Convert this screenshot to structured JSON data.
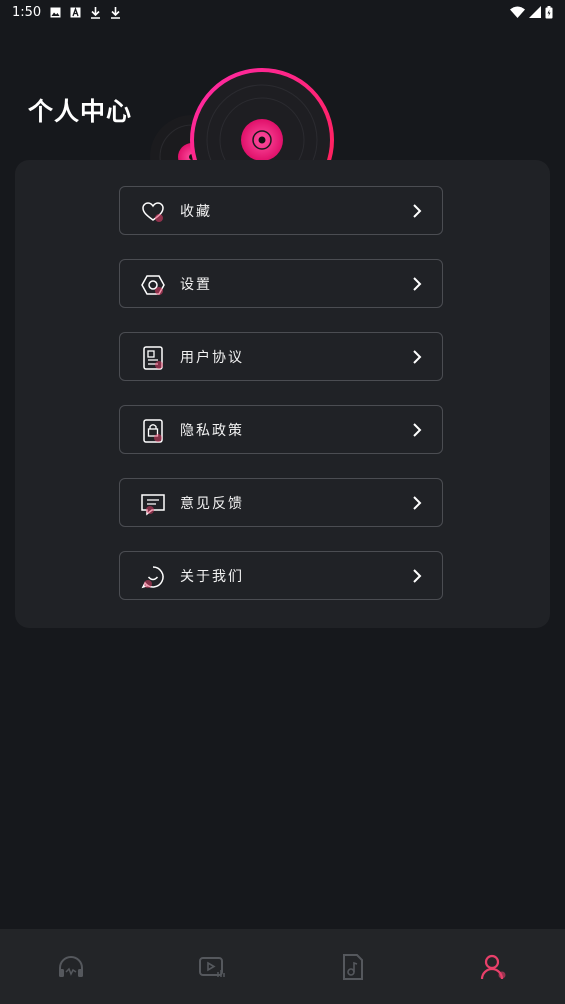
{
  "status_bar": {
    "time": "1:50"
  },
  "header": {
    "title": "个人中心"
  },
  "menu": {
    "items": [
      {
        "label": "收藏",
        "icon": "heart-icon"
      },
      {
        "label": "设置",
        "icon": "settings-hexagon-icon"
      },
      {
        "label": "用户协议",
        "icon": "user-agreement-icon"
      },
      {
        "label": "隐私政策",
        "icon": "privacy-lock-icon"
      },
      {
        "label": "意见反馈",
        "icon": "feedback-message-icon"
      },
      {
        "label": "关于我们",
        "icon": "about-chat-icon"
      }
    ]
  },
  "tab_bar": {
    "tabs": [
      {
        "icon": "headphones-icon",
        "active": false
      },
      {
        "icon": "video-icon",
        "active": false
      },
      {
        "icon": "music-file-icon",
        "active": false
      },
      {
        "icon": "profile-icon",
        "active": true
      }
    ]
  },
  "colors": {
    "accent": "#e8406a",
    "background": "#16181c",
    "card": "#202226"
  }
}
